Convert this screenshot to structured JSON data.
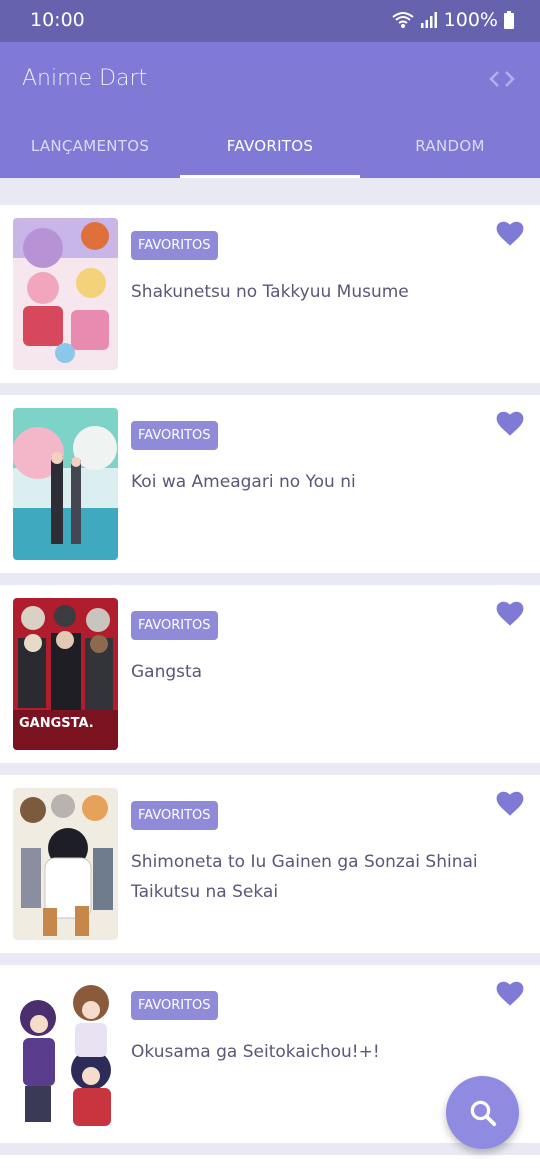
{
  "status": {
    "time": "10:00",
    "battery": "100%"
  },
  "app": {
    "title": "Anime Dart"
  },
  "tabs": [
    {
      "label": "LANÇAMENTOS",
      "active": false
    },
    {
      "label": "FAVORITOS",
      "active": true
    },
    {
      "label": "RANDOM",
      "active": false
    }
  ],
  "items": [
    {
      "badge": "FAVORITOS",
      "title": "Shakunetsu no Takkyuu Musume",
      "poster_text": ""
    },
    {
      "badge": "FAVORITOS",
      "title": "Koi wa Ameagari no You ni",
      "poster_text": ""
    },
    {
      "badge": "FAVORITOS",
      "title": "Gangsta",
      "poster_text": "GANGSTA."
    },
    {
      "badge": "FAVORITOS",
      "title": "Shimoneta to Iu Gainen ga Sonzai Shinai Taikutsu na Sekai",
      "poster_text": ""
    },
    {
      "badge": "FAVORITOS",
      "title": "Okusama ga Seitokaichou!+!",
      "poster_text": ""
    }
  ],
  "colors": {
    "primary": "#7E7AD5",
    "status_bar": "#6563AE",
    "accent": "#8F8BD8",
    "heart": "#7E7AD5"
  },
  "icons": {
    "code": "code-icon",
    "favorite": "heart-icon",
    "search": "search-icon"
  }
}
